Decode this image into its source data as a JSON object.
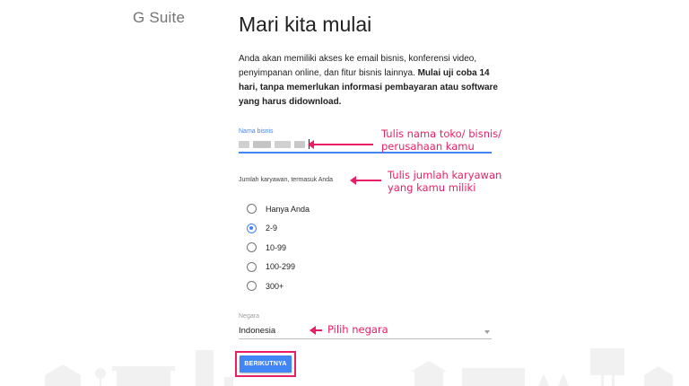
{
  "header": {
    "logo": "G Suite"
  },
  "main": {
    "title": "Mari kita mulai",
    "intro_normal": "Anda akan memiliki akses ke email bisnis, konferensi video, penyimpanan online, dan fitur bisnis lainnya. ",
    "intro_bold": "Mulai uji coba 14 hari, tanpa memerlukan informasi pembayaran atau software yang harus didownload."
  },
  "form": {
    "business_label": "Nama bisnis",
    "employees_label": "Jumlah karyawan, termasuk Anda",
    "employee_options": [
      "Hanya Anda",
      "2-9",
      "10-99",
      "100-299",
      "300+"
    ],
    "employee_selected": "2-9",
    "country_label": "Negara",
    "country_value": "Indonesia",
    "next_button": "BERIKUTNYA"
  },
  "annotations": {
    "business_line1": "Tulis nama toko/ bisnis/",
    "business_line2": "perusahaan kamu",
    "employees_line1": "Tulis jumlah karyawan",
    "employees_line2": "yang kamu miliki",
    "country": "Pilih negara"
  },
  "colors": {
    "accent": "#4285f4",
    "annotation": "#e91e63"
  }
}
